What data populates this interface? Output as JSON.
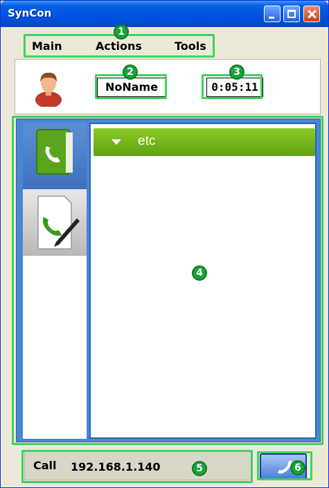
{
  "window": {
    "title": "SynCon"
  },
  "menu": {
    "main": "Main",
    "actions": "Actions",
    "tools": "Tools"
  },
  "profile": {
    "name": "NoName",
    "timer": "0:05:11"
  },
  "contacts": {
    "group_label": "etc"
  },
  "call": {
    "label": "Call",
    "address": "192.168.1.140"
  },
  "annotations": [
    "1",
    "2",
    "3",
    "4",
    "5",
    "6"
  ],
  "colors": {
    "annotation": "#3ed35e",
    "badge": "#17a43a",
    "group_header": "#7bbf1f",
    "panel": "#4a86d4"
  }
}
